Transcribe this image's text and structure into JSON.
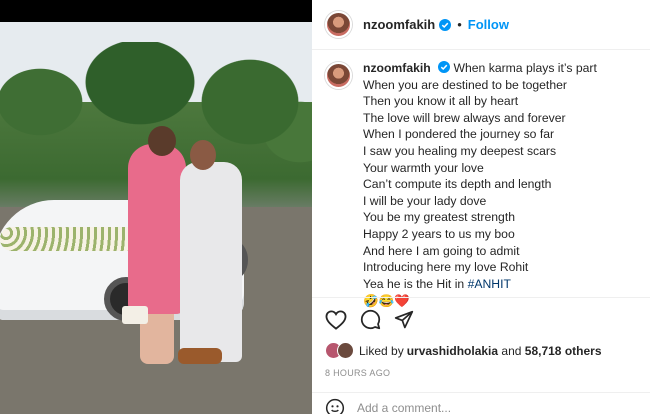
{
  "post": {
    "username": "nzoomfakih",
    "follow_label": "Follow",
    "separator": "•",
    "caption_lines": [
      "When karma plays it’s part",
      "When you are destined to be together",
      "Then you know it all by heart",
      "The love will brew always and forever",
      "When I pondered the journey so far",
      "I saw you healing my deepest scars",
      "Your warmth your love",
      "Can’t compute its depth and length",
      "I will be your lady dove",
      "You be my greatest strength",
      "Happy 2 years to us my boo",
      "And here I am going to admit",
      "Introducing here my love Rohit",
      "Yea he is the Hit in "
    ],
    "hashtag": "#ANHIT",
    "emojis": "🤣😂❤️",
    "liked_by_prefix": "Liked by ",
    "liked_by_user": "urvashidholakia",
    "liked_by_and": " and ",
    "liked_by_others": "58,718 others",
    "time_ago": "8 HOURS AGO",
    "comment_placeholder": "Add a comment..."
  },
  "icons": {
    "verified": "verified-badge-icon",
    "like": "heart-icon",
    "comment": "comment-icon",
    "share": "share-icon",
    "emoji": "emoji-icon"
  },
  "colors": {
    "accent": "#0095f6",
    "hashtag": "#00376b",
    "muted": "#8e8e8e"
  }
}
